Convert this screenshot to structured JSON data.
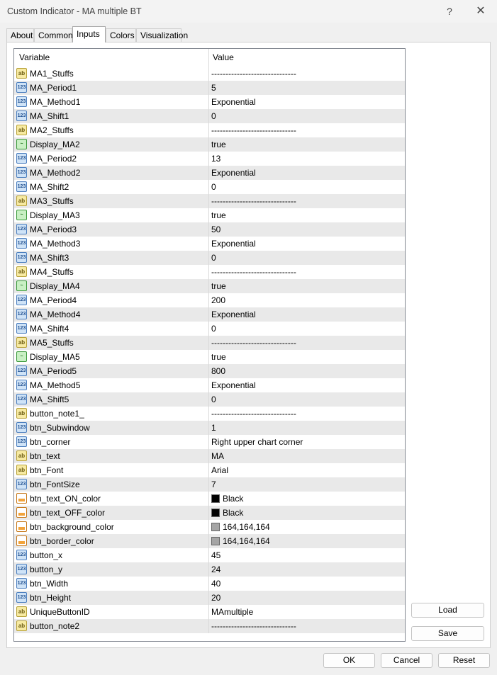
{
  "window": {
    "title": "Custom Indicator - MA multiple BT",
    "help_glyph": "?",
    "close_glyph": "✕"
  },
  "tabs": [
    "About",
    "Common",
    "Inputs",
    "Colors",
    "Visualization"
  ],
  "active_tab": "Inputs",
  "table": {
    "col_variable": "Variable",
    "col_value": "Value",
    "rows": [
      {
        "type": "str",
        "name": "MA1_Stuffs",
        "value": "------------------------------"
      },
      {
        "type": "int",
        "name": "MA_Period1",
        "value": "5"
      },
      {
        "type": "int",
        "name": "MA_Method1",
        "value": "Exponential"
      },
      {
        "type": "int",
        "name": "MA_Shift1",
        "value": "0"
      },
      {
        "type": "str",
        "name": "MA2_Stuffs",
        "value": "------------------------------"
      },
      {
        "type": "bool",
        "name": "Display_MA2",
        "value": "true"
      },
      {
        "type": "int",
        "name": "MA_Period2",
        "value": "13"
      },
      {
        "type": "int",
        "name": "MA_Method2",
        "value": "Exponential"
      },
      {
        "type": "int",
        "name": "MA_Shift2",
        "value": "0"
      },
      {
        "type": "str",
        "name": "MA3_Stuffs",
        "value": "------------------------------"
      },
      {
        "type": "bool",
        "name": "Display_MA3",
        "value": "true"
      },
      {
        "type": "int",
        "name": "MA_Period3",
        "value": "50"
      },
      {
        "type": "int",
        "name": "MA_Method3",
        "value": "Exponential"
      },
      {
        "type": "int",
        "name": "MA_Shift3",
        "value": "0"
      },
      {
        "type": "str",
        "name": "MA4_Stuffs",
        "value": "------------------------------"
      },
      {
        "type": "bool",
        "name": "Display_MA4",
        "value": "true"
      },
      {
        "type": "int",
        "name": "MA_Period4",
        "value": "200"
      },
      {
        "type": "int",
        "name": "MA_Method4",
        "value": "Exponential"
      },
      {
        "type": "int",
        "name": "MA_Shift4",
        "value": "0"
      },
      {
        "type": "str",
        "name": "MA5_Stuffs",
        "value": "------------------------------"
      },
      {
        "type": "bool",
        "name": "Display_MA5",
        "value": "true"
      },
      {
        "type": "int",
        "name": "MA_Period5",
        "value": "800"
      },
      {
        "type": "int",
        "name": "MA_Method5",
        "value": "Exponential"
      },
      {
        "type": "int",
        "name": "MA_Shift5",
        "value": "0"
      },
      {
        "type": "str",
        "name": "button_note1_",
        "value": "------------------------------"
      },
      {
        "type": "int",
        "name": "btn_Subwindow",
        "value": "1"
      },
      {
        "type": "int",
        "name": "btn_corner",
        "value": "Right upper chart corner"
      },
      {
        "type": "str",
        "name": "btn_text",
        "value": "MA"
      },
      {
        "type": "str",
        "name": "btn_Font",
        "value": "Arial"
      },
      {
        "type": "int",
        "name": "btn_FontSize",
        "value": "7"
      },
      {
        "type": "color",
        "name": "btn_text_ON_color",
        "value": "Black",
        "swatch": "#000000"
      },
      {
        "type": "color",
        "name": "btn_text_OFF_color",
        "value": "Black",
        "swatch": "#000000"
      },
      {
        "type": "color",
        "name": "btn_background_color",
        "value": "164,164,164",
        "swatch": "#a4a4a4"
      },
      {
        "type": "color",
        "name": "btn_border_color",
        "value": "164,164,164",
        "swatch": "#a4a4a4"
      },
      {
        "type": "int",
        "name": "button_x",
        "value": "45"
      },
      {
        "type": "int",
        "name": "button_y",
        "value": "24"
      },
      {
        "type": "int",
        "name": "btn_Width",
        "value": "40"
      },
      {
        "type": "int",
        "name": "btn_Height",
        "value": "20"
      },
      {
        "type": "str",
        "name": "UniqueButtonID",
        "value": "MAmultiple"
      },
      {
        "type": "str",
        "name": "button_note2",
        "value": "------------------------------"
      }
    ]
  },
  "icon_labels": {
    "int": "123",
    "str": "ab",
    "bool": "~"
  },
  "side_buttons": {
    "load": "Load",
    "save": "Save"
  },
  "footer_buttons": {
    "ok": "OK",
    "cancel": "Cancel",
    "reset": "Reset"
  }
}
